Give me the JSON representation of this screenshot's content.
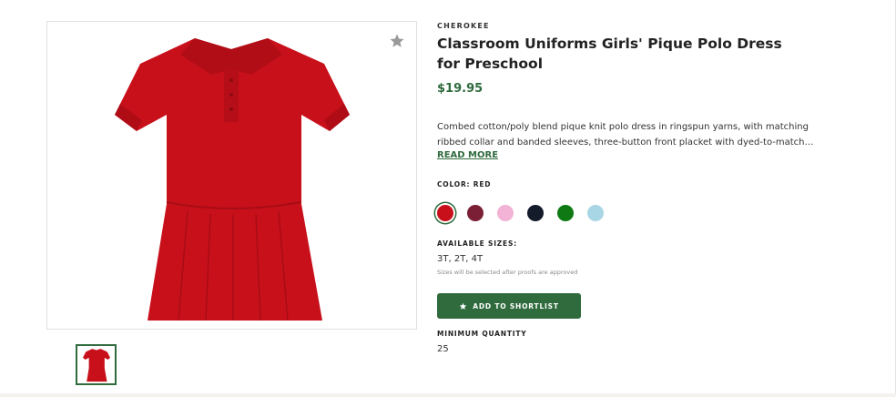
{
  "product": {
    "brand": "CHEROKEE",
    "title": "Classroom Uniforms Girls' Pique Polo Dress for Preschool",
    "price": "$19.95",
    "description": "Combed cotton/poly blend pique knit polo dress in ringspun yarns, with matching ribbed collar and banded sleeves, three-button front placket with dyed-to-match…",
    "read_more_label": "READ MORE",
    "image_icon": "red-polo-dress-image",
    "favorite_icon": "star-icon"
  },
  "color": {
    "label": "COLOR:",
    "selected": "RED",
    "swatches": [
      {
        "name": "red",
        "hex": "#c8101b"
      },
      {
        "name": "maroon",
        "hex": "#7a1f35"
      },
      {
        "name": "pink",
        "hex": "#f2b3d6"
      },
      {
        "name": "navy",
        "hex": "#141c2b"
      },
      {
        "name": "green",
        "hex": "#0f7a14"
      },
      {
        "name": "light-blue",
        "hex": "#a9d6e5"
      }
    ]
  },
  "sizes": {
    "label": "AVAILABLE SIZES:",
    "value": "3T, 2T, 4T",
    "note": "Sizes will be selected after proofs are approved"
  },
  "shortlist": {
    "label": "ADD TO SHORTLIST",
    "icon": "star-icon"
  },
  "minimum_quantity": {
    "label": "MINIMUM QUANTITY",
    "value": "25"
  },
  "colors": {
    "accent": "#2f6b3d",
    "dress": "#c8101b"
  }
}
